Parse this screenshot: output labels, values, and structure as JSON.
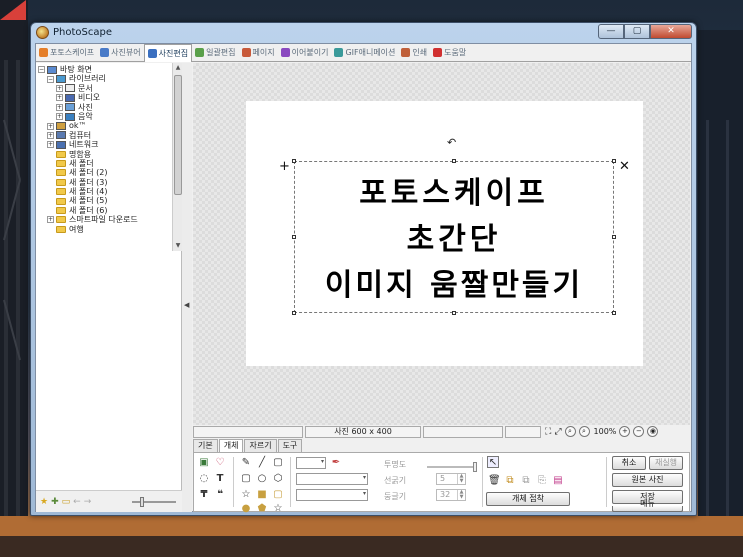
{
  "window": {
    "title": "PhotoScape",
    "btn_min": "—",
    "btn_max": "▢",
    "btn_close": "✕"
  },
  "tabs": [
    {
      "label": "포토스케이프",
      "color": "#e57f2a"
    },
    {
      "label": "사진뷰어",
      "color": "#4a7bc8"
    },
    {
      "label": "사진편집",
      "color": "#3a6fc0"
    },
    {
      "label": "일괄편집",
      "color": "#5aa04a"
    },
    {
      "label": "페이지",
      "color": "#c85a3a"
    },
    {
      "label": "이어붙이기",
      "color": "#8a4ac0"
    },
    {
      "label": "GIF애니메이션",
      "color": "#3a9a9a"
    },
    {
      "label": "인쇄",
      "color": "#c0603a"
    },
    {
      "label": "도움말",
      "color": "#d03030"
    }
  ],
  "tree": {
    "items": [
      {
        "label": "바탕 화면",
        "level": 0,
        "toggle": "⊟",
        "kind": "desktop"
      },
      {
        "label": "라이브러리",
        "level": 1,
        "toggle": "⊟",
        "kind": "lib"
      },
      {
        "label": "문서",
        "level": 2,
        "toggle": "⊞",
        "kind": "doc"
      },
      {
        "label": "비디오",
        "level": 2,
        "toggle": "⊞",
        "kind": "video"
      },
      {
        "label": "사진",
        "level": 2,
        "toggle": "⊞",
        "kind": "pic"
      },
      {
        "label": "음악",
        "level": 2,
        "toggle": "⊞",
        "kind": "music"
      },
      {
        "label": "ok™",
        "level": 1,
        "toggle": "⊞",
        "kind": "user"
      },
      {
        "label": "컴퓨터",
        "level": 1,
        "toggle": "⊞",
        "kind": "pc"
      },
      {
        "label": "네트워크",
        "level": 1,
        "toggle": "⊞",
        "kind": "net"
      },
      {
        "label": "명함용",
        "level": 1,
        "toggle": "",
        "kind": "folder"
      },
      {
        "label": "새 폴더",
        "level": 1,
        "toggle": "",
        "kind": "folder"
      },
      {
        "label": "새 폴더 (2)",
        "level": 1,
        "toggle": "",
        "kind": "folder"
      },
      {
        "label": "새 폴더 (3)",
        "level": 1,
        "toggle": "",
        "kind": "folder"
      },
      {
        "label": "새 폴더 (4)",
        "level": 1,
        "toggle": "",
        "kind": "folder"
      },
      {
        "label": "새 폴더 (5)",
        "level": 1,
        "toggle": "",
        "kind": "folder"
      },
      {
        "label": "새 폴더 (6)",
        "level": 1,
        "toggle": "",
        "kind": "folder"
      },
      {
        "label": "스마트파일 다운로드",
        "level": 1,
        "toggle": "⊞",
        "kind": "folder"
      },
      {
        "label": "여행",
        "level": 1,
        "toggle": "",
        "kind": "folder"
      }
    ]
  },
  "canvas": {
    "lines": [
      "포토스케이프",
      "초간단",
      "이미지 움짤만들기"
    ],
    "rotate_glyph": "↶",
    "add_glyph": "+",
    "delete_glyph": "✕"
  },
  "status": {
    "size_label": "사진 600 x 400",
    "zoom": "100%"
  },
  "bottom_tabs": [
    "기본",
    "개체",
    "자르기",
    "도구"
  ],
  "object_panel": {
    "opacity_label": "투명도",
    "thickness_label": "선굵기",
    "thickness_value": "5",
    "radius_label": "둥글기",
    "radius_value": "32",
    "group_button": "개체 접착"
  },
  "actions": {
    "cancel": "취소",
    "redo": "재실행",
    "original": "원본 사진",
    "save": "저장",
    "menu": "메뉴"
  }
}
